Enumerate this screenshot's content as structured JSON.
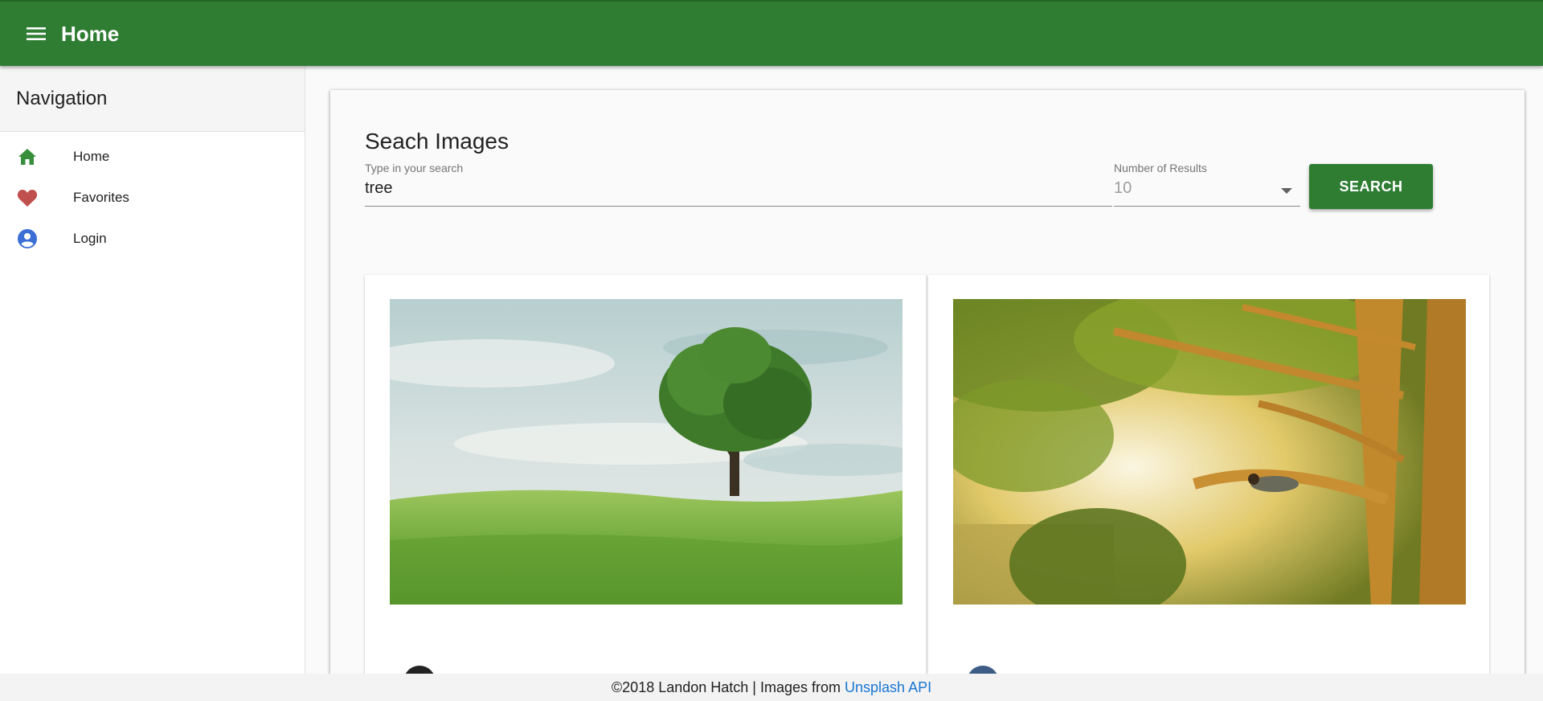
{
  "appbar": {
    "title": "Home",
    "menu_icon": "menu-icon",
    "color": "#2e7d32"
  },
  "sidebar": {
    "header": "Navigation",
    "items": [
      {
        "label": "Home",
        "icon": "home-icon",
        "icon_color": "#388e3c"
      },
      {
        "label": "Favorites",
        "icon": "heart-icon",
        "icon_color": "#c0504d"
      },
      {
        "label": "Login",
        "icon": "account-circle-icon",
        "icon_color": "#3b6fd6"
      }
    ]
  },
  "search": {
    "title": "Seach Images",
    "query_label": "Type in your search",
    "query_value": "tree",
    "results_label": "Number of Results",
    "results_value": "10",
    "button_label": "SEARCH"
  },
  "results": [
    {
      "image": "lone-tree-in-grass-field"
    },
    {
      "image": "person-resting-in-large-tree"
    }
  ],
  "footer": {
    "text": "©2018 Landon Hatch | Images from",
    "link_text": "Unsplash API",
    "link_color": "#1976d2"
  }
}
